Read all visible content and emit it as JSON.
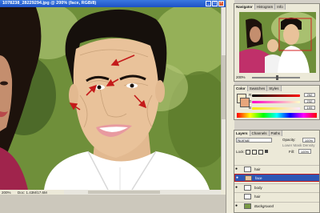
{
  "window": {
    "title": "1078238_28229294.jpg @ 200% (face, RGB/8)",
    "zoom": "200%",
    "doc_info": "Doc: 1.43M/17.6M"
  },
  "navigator": {
    "tabs": [
      "Navigator",
      "Histogram",
      "Info"
    ],
    "zoom": "200%"
  },
  "color": {
    "tabs": [
      "Color",
      "Swatches",
      "Styles"
    ],
    "channels": [
      {
        "label": "R",
        "value": "252"
      },
      {
        "label": "G",
        "value": "232"
      },
      {
        "label": "B",
        "value": "199"
      }
    ]
  },
  "layers": {
    "tabs": [
      "Layers",
      "Channels",
      "Paths"
    ],
    "blend_mode": "Normal",
    "opacity_label": "Opacity:",
    "opacity_value": "100%",
    "fill_label": "Fill:",
    "fill_value": "100%",
    "lock_label": "Lock:",
    "extra_label": "Lower Mask Density",
    "items": [
      {
        "name": "hair",
        "selected": false,
        "visible": true
      },
      {
        "name": "face",
        "selected": true,
        "visible": true
      },
      {
        "name": "body",
        "selected": false,
        "visible": true
      },
      {
        "name": "hair",
        "selected": false,
        "visible": false
      },
      {
        "name": "Background",
        "selected": false,
        "visible": true
      }
    ]
  },
  "colors": {
    "skin": "#e9c29a",
    "accent_red": "#c41a1a",
    "selection": "#2d56b5"
  }
}
